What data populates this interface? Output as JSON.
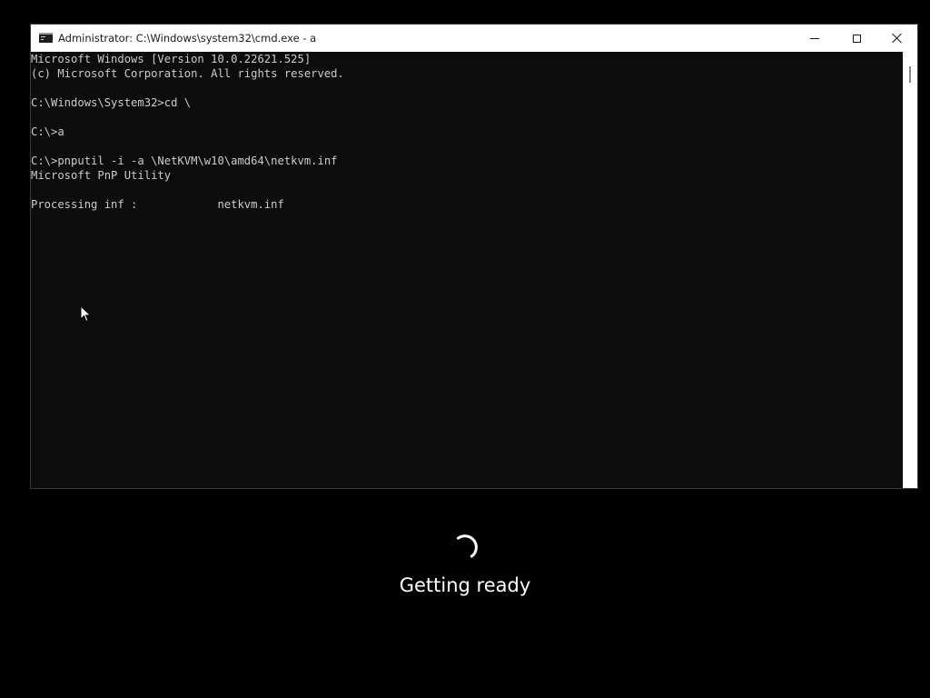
{
  "window": {
    "title": "Administrator: C:\\Windows\\system32\\cmd.exe - a",
    "app_icon": "cmd-icon",
    "controls": {
      "minimize": "minimize-icon",
      "maximize": "maximize-icon",
      "close": "close-icon"
    }
  },
  "console": {
    "background": "#0c0c0c",
    "foreground": "#cccccc",
    "lines": [
      "Microsoft Windows [Version 10.0.22621.525]",
      "(c) Microsoft Corporation. All rights reserved.",
      "",
      "C:\\Windows\\System32>cd \\",
      "",
      "C:\\>a",
      "",
      "C:\\>pnputil -i -a \\NetKVM\\w10\\amd64\\netkvm.inf",
      "Microsoft PnP Utility",
      "",
      "Processing inf :            netkvm.inf"
    ]
  },
  "setup": {
    "status": "Getting ready",
    "spinner_icon": "loading-spinner-icon"
  }
}
